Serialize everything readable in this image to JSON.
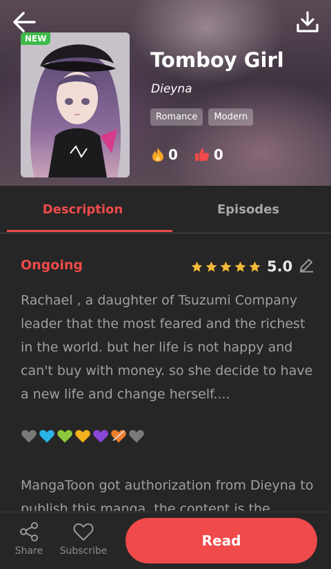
{
  "header": {
    "badge": "NEW",
    "title": "Tomboy Girl",
    "author": "Dieyna",
    "tags": [
      "Romance",
      "Modern"
    ],
    "hot_count": "0",
    "like_count": "0"
  },
  "tabs": [
    {
      "label": "Description",
      "active": true
    },
    {
      "label": "Episodes",
      "active": false
    }
  ],
  "details": {
    "status": "Ongoing",
    "rating": "5.0",
    "star_count": 5,
    "description": "Rachael , a daughter of Tsuzumi Company leader that the most feared and the richest in the world. but her life is not happy and can't buy with money. so she decide to have a new life and change herself....",
    "hearts": [
      "#7a7a7a",
      "#2ab3e6",
      "#8cc83c",
      "#f2b11d",
      "#8a46d6",
      "#f07f2e",
      "#7a7a7a"
    ],
    "authorization": "MangaToon got authorization from Dieyna to publish this manga, the content is the"
  },
  "bottom": {
    "share_label": "Share",
    "subscribe_label": "Subscribe",
    "read_label": "Read"
  },
  "colors": {
    "accent": "#f04a4a",
    "badge_green": "#3dbb4a",
    "star": "#f5b93a",
    "background": "#262626"
  }
}
